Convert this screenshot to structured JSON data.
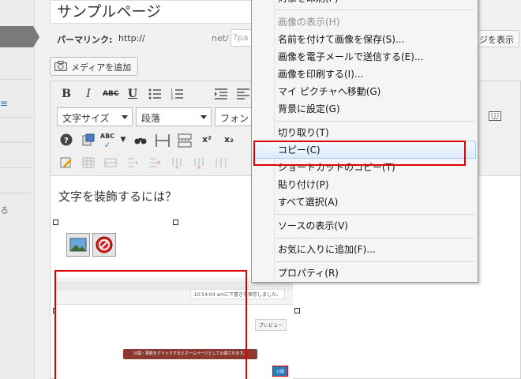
{
  "sidebar": {
    "fragment_icon": "≡",
    "fragment_text": "る"
  },
  "title": {
    "value": "サンプルページ"
  },
  "permalink": {
    "label": "パーマリンク:",
    "url": "http://",
    "domain_suffix": "net/",
    "slug": "?pa",
    "view_button": "ジを表示"
  },
  "media": {
    "add_button": "メディアを追加"
  },
  "toolbar": {
    "bold": "B",
    "italic": "I",
    "strike": "ABC",
    "underline": "U",
    "font_size": "文字サイズ",
    "paragraph": "段落",
    "font_family": "フォント",
    "superscript": "x²",
    "subscript": "x₂",
    "spellcheck": "ABC"
  },
  "content": {
    "heading": "文字を装飾するには？",
    "embedded": {
      "status": "10:54:04 amに下書きを保存しました。",
      "preview": "プレビュー",
      "tooltip": "公開・更新をクリックするとホームページとして公開されます。",
      "publish": "公開"
    }
  },
  "context_menu": {
    "print_partial": "対象を印刷(P)",
    "items": [
      {
        "label": "画像の表示(H)",
        "disabled": true
      },
      {
        "label": "名前を付けて画像を保存(S)..."
      },
      {
        "label": "画像を電子メールで送信する(E)..."
      },
      {
        "label": "画像を印刷する(I)..."
      },
      {
        "label": "マイ ピクチャへ移動(G)"
      },
      {
        "label": "背景に設定(G)"
      },
      {
        "label": "切り取り(T)"
      },
      {
        "label": "コピー(C)",
        "highlighted": true
      },
      {
        "label": "ショートカットのコピー(T)"
      },
      {
        "label": "貼り付け(P)"
      },
      {
        "label": "すべて選択(A)"
      },
      {
        "label": "ソースの表示(V)"
      },
      {
        "label": "お気に入りに追加(F)..."
      },
      {
        "label": "プロパティ(R)"
      }
    ]
  },
  "colors": {
    "highlight_border": "#e00000",
    "menu_highlight": "#dcebfc",
    "link_blue": "#2271b1"
  }
}
